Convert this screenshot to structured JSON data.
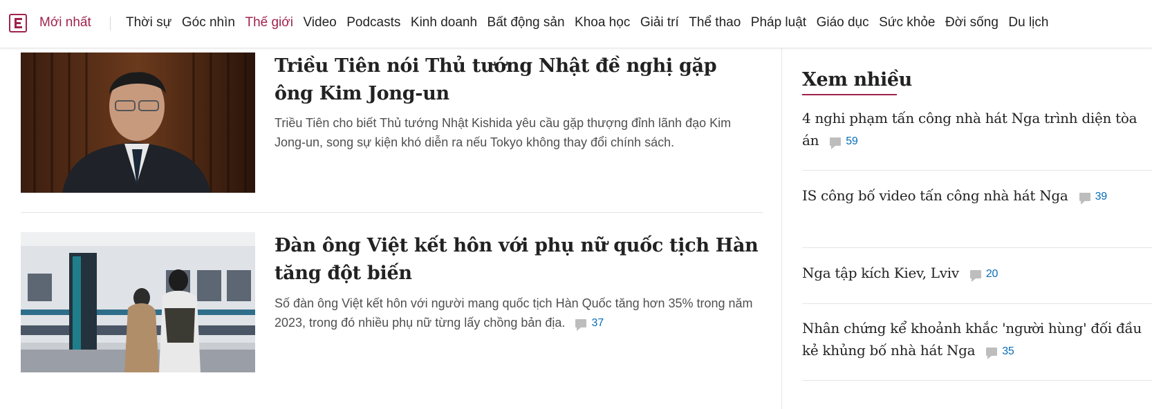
{
  "nav": {
    "latest": "Mới nhất",
    "items": [
      {
        "label": "Thời sự",
        "active": false
      },
      {
        "label": "Góc nhìn",
        "active": false
      },
      {
        "label": "Thế giới",
        "active": true
      },
      {
        "label": "Video",
        "active": false
      },
      {
        "label": "Podcasts",
        "active": false
      },
      {
        "label": "Kinh doanh",
        "active": false
      },
      {
        "label": "Bất động sản",
        "active": false
      },
      {
        "label": "Khoa học",
        "active": false
      },
      {
        "label": "Giải trí",
        "active": false
      },
      {
        "label": "Thể thao",
        "active": false
      },
      {
        "label": "Pháp luật",
        "active": false
      },
      {
        "label": "Giáo dục",
        "active": false
      },
      {
        "label": "Sức khỏe",
        "active": false
      },
      {
        "label": "Đời sống",
        "active": false
      },
      {
        "label": "Du lịch",
        "active": false
      }
    ]
  },
  "articles": [
    {
      "title": "Triều Tiên nói Thủ tướng Nhật đề nghị gặp ông Kim Jong-un",
      "description": "Triều Tiên cho biết Thủ tướng Nhật Kishida yêu cầu gặp thượng đỉnh lãnh đạo Kim Jong-un, song sự kiện khó diễn ra nếu Tokyo không thay đổi chính sách.",
      "comments": ""
    },
    {
      "title": "Đàn ông Việt kết hôn với phụ nữ quốc tịch Hàn tăng đột biến",
      "description": "Số đàn ông Việt kết hôn với người mang quốc tịch Hàn Quốc tăng hơn 35% trong năm 2023, trong đó nhiều phụ nữ từng lấy chồng bản địa.",
      "comments": "37"
    }
  ],
  "sidebar": {
    "title": "Xem nhiều",
    "items": [
      {
        "title": "4 nghi phạm tấn công nhà hát Nga trình diện tòa án",
        "comments": "59"
      },
      {
        "title": "IS công bố video tấn công nhà hát Nga",
        "comments": "39"
      },
      {
        "title": "Nga tập kích Kiev, Lviv",
        "comments": "20"
      },
      {
        "title": "Nhân chứng kể khoảnh khắc 'người hùng' đối đầu kẻ khủng bố nhà hát Nga",
        "comments": "35"
      }
    ]
  },
  "colors": {
    "brand": "#9f224e",
    "comment_count": "#076db6"
  }
}
